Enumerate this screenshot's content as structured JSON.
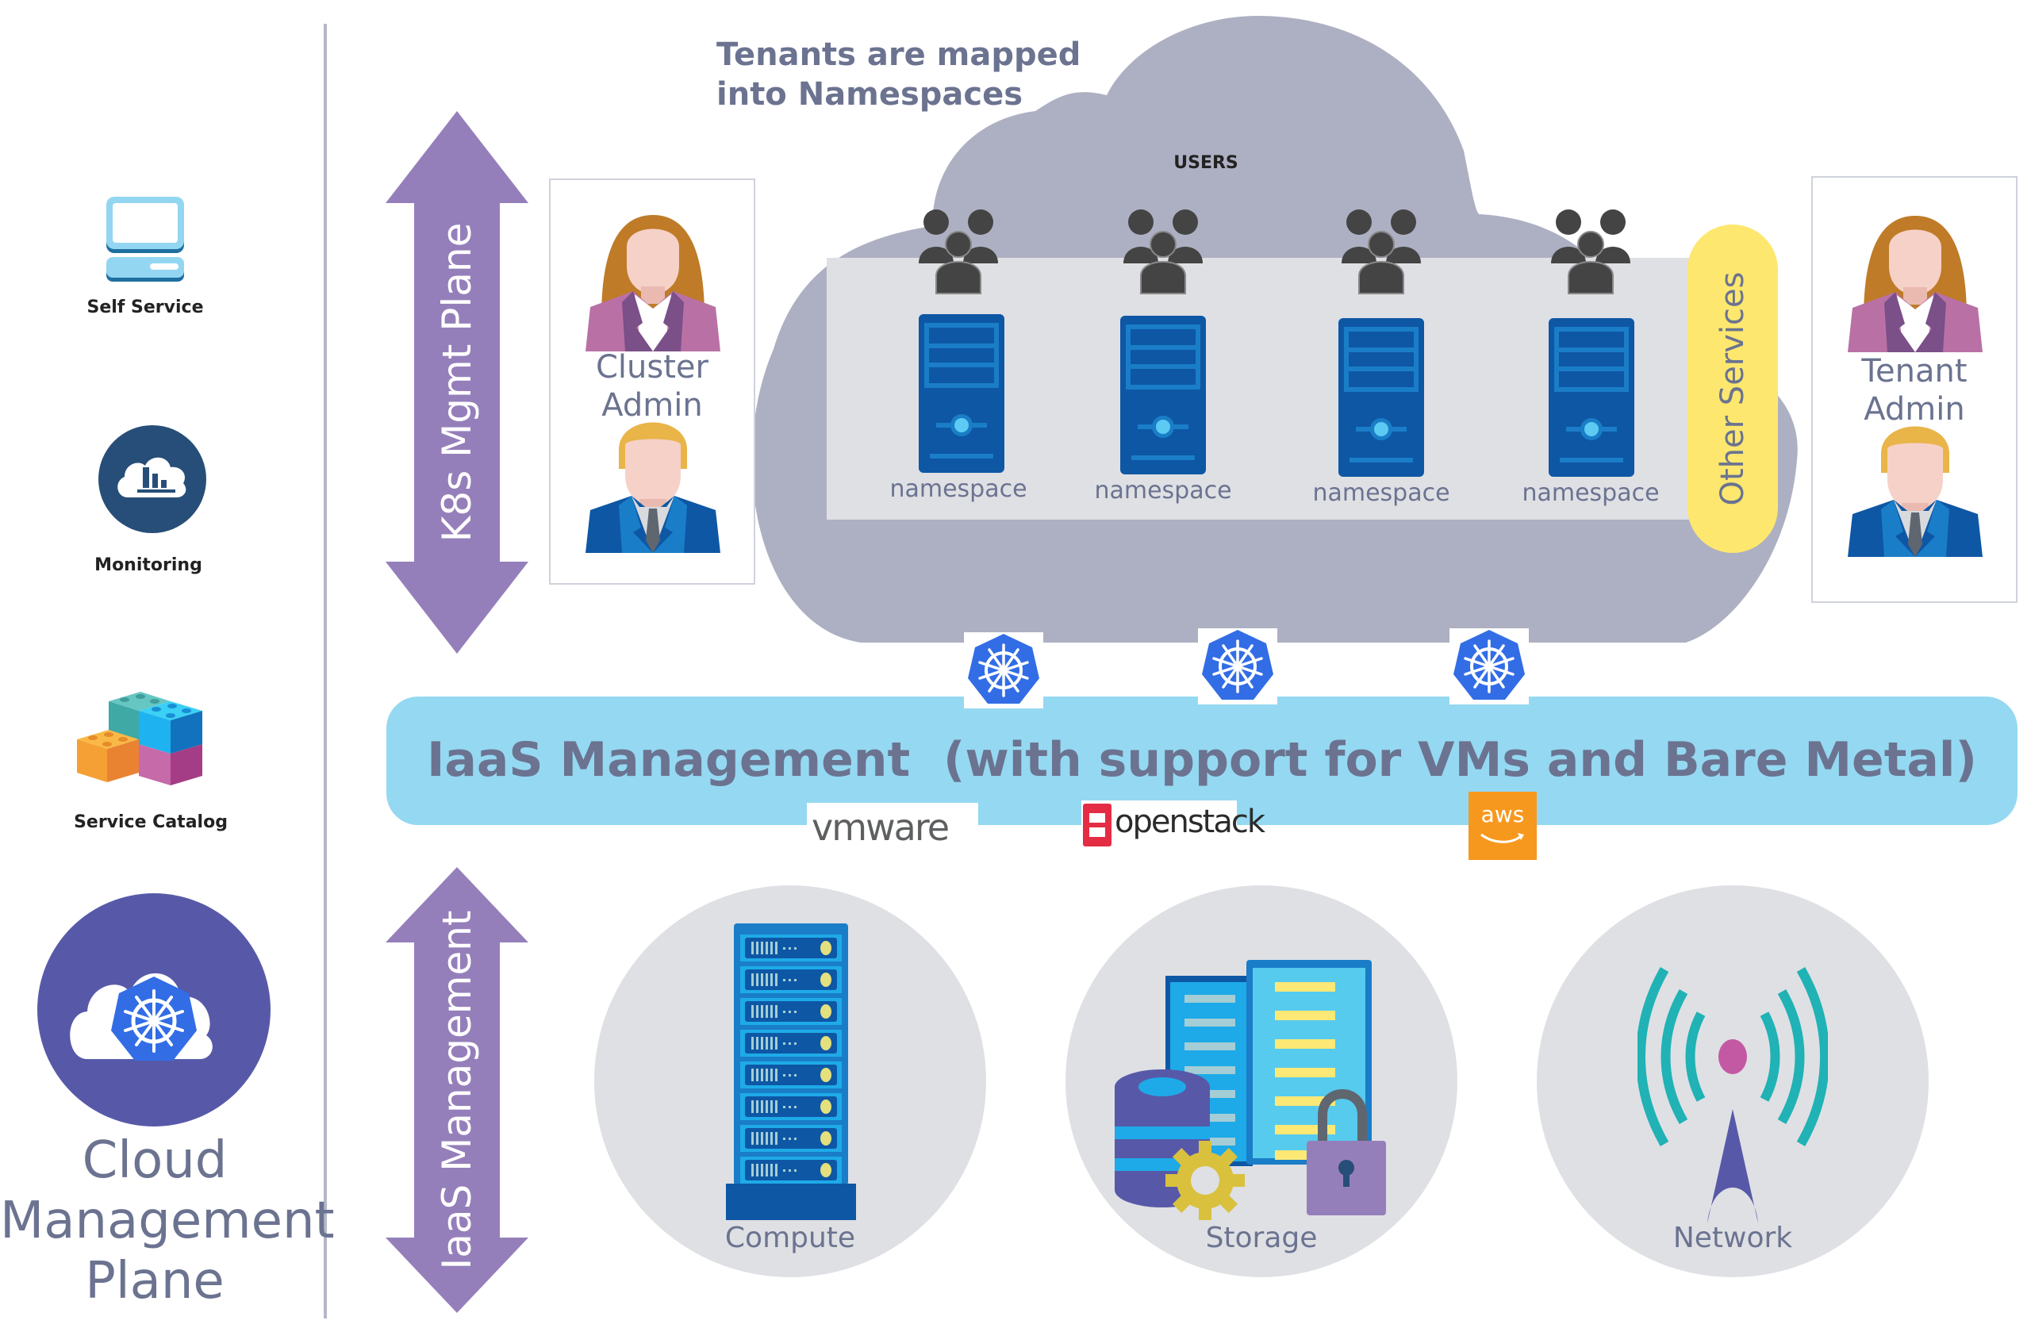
{
  "sidebar": {
    "items": [
      {
        "label": "Self Service",
        "icon": "laptop-icon"
      },
      {
        "label": "Monitoring",
        "icon": "cloud-chart-icon"
      },
      {
        "label": "Service Catalog",
        "icon": "blocks-icon"
      }
    ],
    "plane_title_lines": [
      "Cloud",
      "Management",
      "Plane"
    ]
  },
  "arrows": {
    "top": "K8s Mgmt Plane",
    "bottom": "IaaS Management"
  },
  "cloud": {
    "caption_lines": [
      "Tenants are mapped",
      "into Namespaces"
    ],
    "users_label": "USERS",
    "namespaces": [
      "namespace",
      "namespace",
      "namespace",
      "namespace"
    ],
    "other_services": "Other Services"
  },
  "admins": {
    "cluster": [
      "Cluster",
      "Admin"
    ],
    "tenant": [
      "Tenant",
      "Admin"
    ]
  },
  "iaas": {
    "banner": "IaaS Management  (with support for VMs and Bare Metal)",
    "providers": [
      {
        "name": "vmware",
        "label": "vmware"
      },
      {
        "name": "openstack",
        "label": "openstack"
      },
      {
        "name": "aws",
        "label": "aws"
      }
    ]
  },
  "resources": [
    "Compute",
    "Storage",
    "Network"
  ],
  "colors": {
    "arrow": "#957fba",
    "cloud": "#adb0c2",
    "namespace_panel": "#dfe0e4",
    "server_blue": "#0e57a5",
    "banner": "#95d8f1",
    "other_services": "#fde76e",
    "k8s_blue": "#326de6",
    "plane_circle": "#5759a8",
    "text_gray": "#6b7390"
  }
}
